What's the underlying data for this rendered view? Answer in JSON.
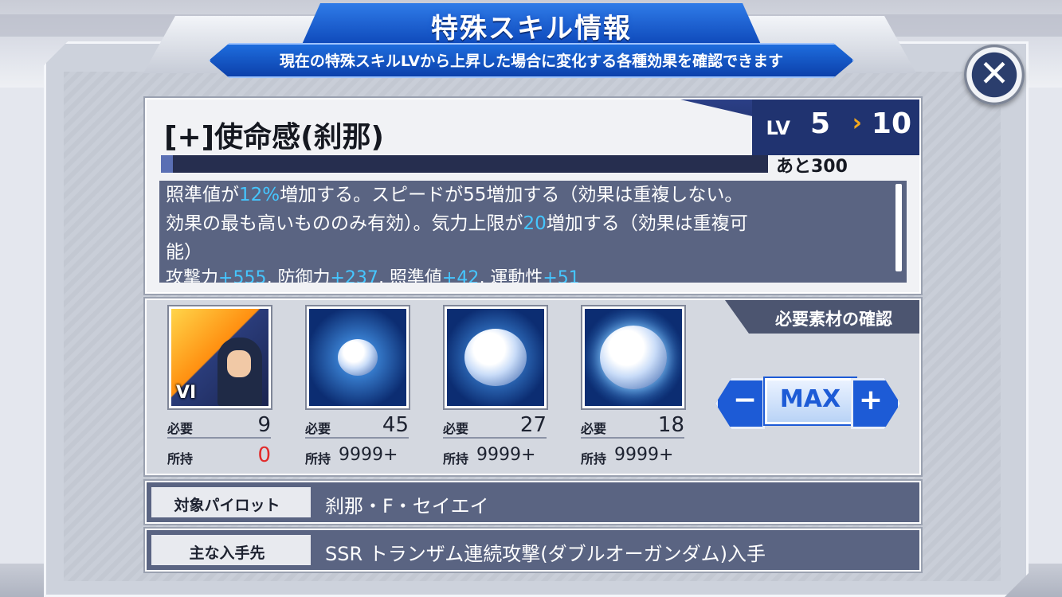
{
  "header": {
    "title": "特殊スキル情報",
    "subtitle": "現在の特殊スキルLVから上昇した場合に変化する各種効果を確認できます",
    "close_icon": "close-icon"
  },
  "skill": {
    "name": "[+]使命感(刹那)",
    "lv_label": "LV",
    "lv_current": "5",
    "lv_next": "10",
    "exp_progress": 0.02,
    "exp_remaining": "あと300",
    "description": {
      "line1_a": "照準値が",
      "line1_hl": "12%",
      "line1_b": "増加する。スピードが55増加する（効果は重複しない。",
      "line2_a": "効果の最も高いもののみ有効）。気力上限が",
      "line2_hl": "20",
      "line2_b": "増加する（効果は重複可",
      "line3": "能）",
      "stats": [
        {
          "label": "攻撃力",
          "value": "+555"
        },
        {
          "label": "防御力",
          "value": "+237"
        },
        {
          "label": "照準値",
          "value": "+42"
        },
        {
          "label": "運動性",
          "value": "+51"
        }
      ]
    }
  },
  "materials": {
    "section_title": "必要素材の確認",
    "need_label": "必要",
    "have_label": "所持",
    "items": [
      {
        "icon": "pilot-card-icon",
        "badge": "VI",
        "need": "9",
        "have": "0"
      },
      {
        "icon": "small-orb-icon",
        "need": "45",
        "have": "9999+"
      },
      {
        "icon": "medium-orb-icon",
        "need": "27",
        "have": "9999+"
      },
      {
        "icon": "large-orb-icon",
        "need": "18",
        "have": "9999+"
      }
    ],
    "stepper": {
      "minus": "−",
      "max": "MAX",
      "plus": "+"
    }
  },
  "info": {
    "pilot_label": "対象パイロット",
    "pilot_value": "刹那・F・セイエイ",
    "source_label": "主な入手先",
    "source_value": "SSR トランザム連続攻撃(ダブルオーガンダム)入手"
  },
  "colors": {
    "accent": "#1d5bd6",
    "highlight": "#45c6ff",
    "warning": "#e22a2a",
    "panel_dark": "#5a6482"
  }
}
